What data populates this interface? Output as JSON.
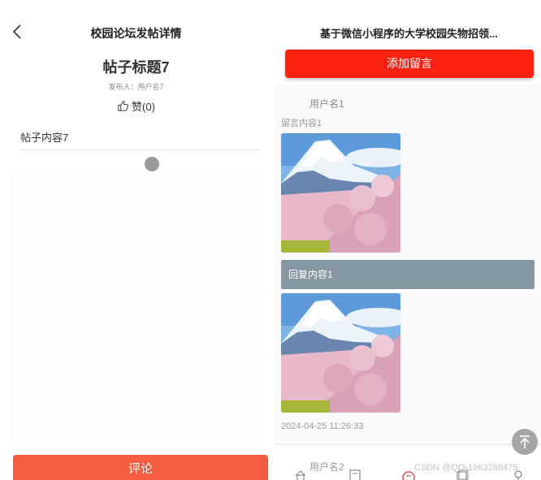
{
  "left": {
    "nav_title": "校园论坛发帖详情",
    "post_title": "帖子标题7",
    "publisher": "发布人：用户名7",
    "like_label": "赞(0)",
    "post_content": "帖子内容7",
    "comment_label": "评论"
  },
  "right": {
    "title": "基于微信小程序的大学校园失物招领...",
    "add_label": "添加留言",
    "messages": [
      {
        "user": "用户名1",
        "content": "留言内容1",
        "reply": "回复内容1",
        "time": "2024-04-25 11:26:33"
      },
      {
        "user": "用户名2"
      }
    ]
  },
  "watermark": "CSDN @QQ-1963288475",
  "colors": {
    "comment_button": "#f25c40",
    "add_button": "#fa2312",
    "reply_bar": "#8797a2"
  },
  "icons": {
    "back": "chevron-left-icon",
    "like": "thumbs-up-icon",
    "scroll_top": "arrow-up-to-top-icon"
  }
}
